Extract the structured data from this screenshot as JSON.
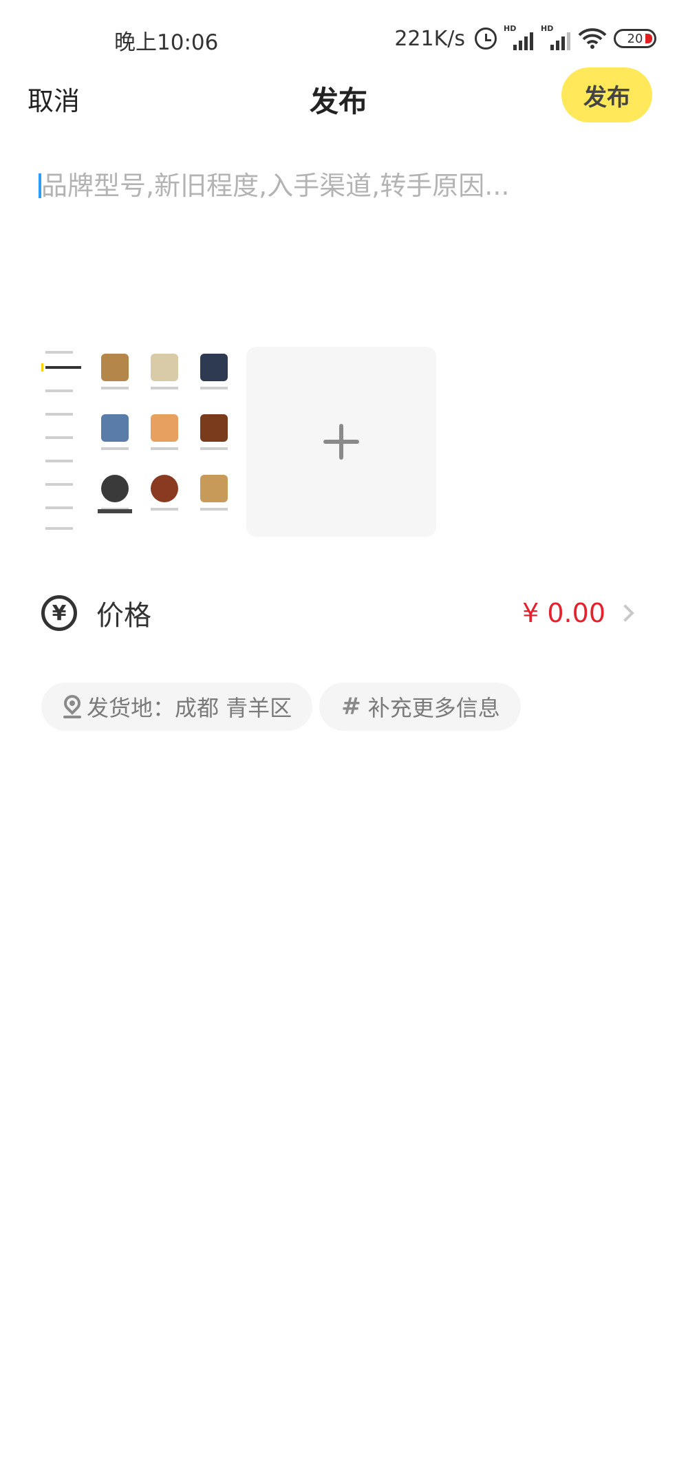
{
  "status_bar": {
    "time": "晚上10:06",
    "net_speed": "221K/s",
    "signal_label": "HD",
    "battery": "20"
  },
  "header": {
    "cancel_label": "取消",
    "title": "发布",
    "publish_label": "发布"
  },
  "description": {
    "placeholder": "品牌型号,新旧程度,入手渠道,转手原因...",
    "value": ""
  },
  "photos": {
    "add_icon": "plus-icon"
  },
  "price": {
    "icon": "yen-circle-icon",
    "label": "价格",
    "value": "¥ 0.00"
  },
  "tags": {
    "location": "发货地：成都 青羊区",
    "more_info": "补充更多信息"
  },
  "colors": {
    "accent": "#ffe85a",
    "price": "#e4212d",
    "caret": "#2d9cff"
  }
}
